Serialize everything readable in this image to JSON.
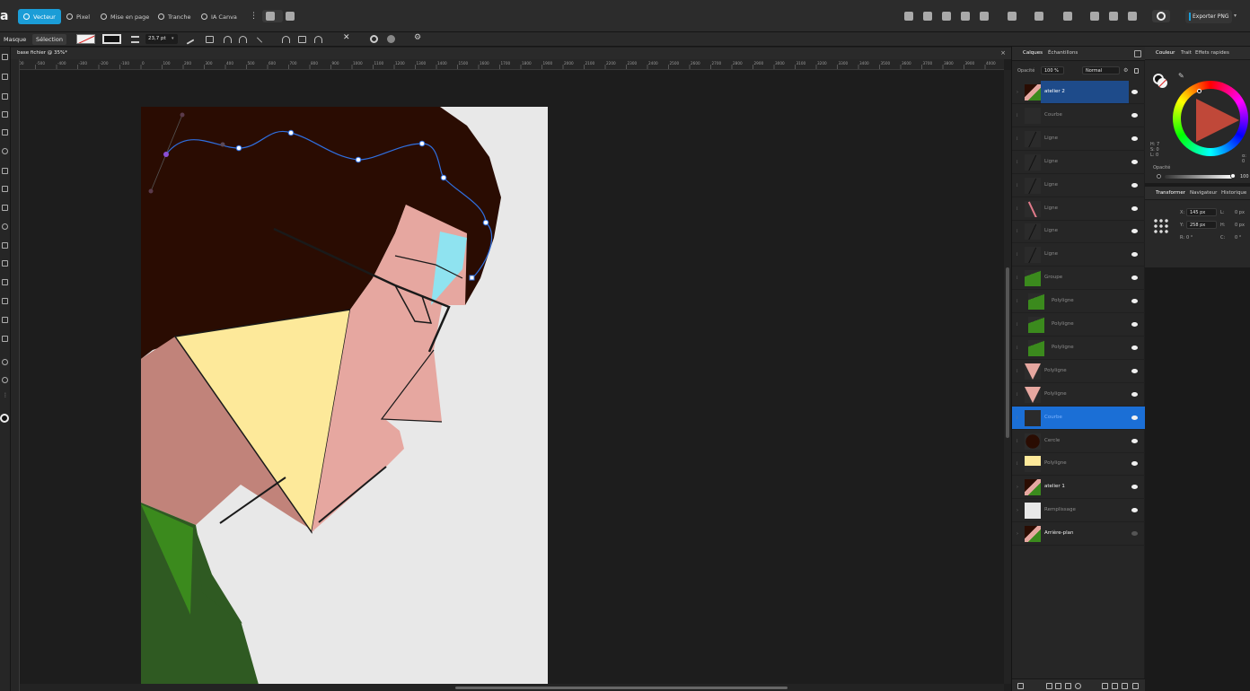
{
  "topbar": {
    "personas": [
      {
        "label": "Vecteur",
        "active": true
      },
      {
        "label": "Pixel",
        "active": false
      },
      {
        "label": "Mise en page",
        "active": false
      },
      {
        "label": "Tranche",
        "active": false
      },
      {
        "label": "IA Canva",
        "active": false
      }
    ],
    "export_label": "Exporter PNG"
  },
  "context": {
    "mask_label": "Masque",
    "selection_label": "Sélection",
    "stroke_width": "23,7 pt"
  },
  "document": {
    "tab_title": "base fichier @ 35%*",
    "close_glyph": "×"
  },
  "ruler": {
    "ticks": [
      "-600",
      "-500",
      "-400",
      "-300",
      "-200",
      "-100",
      "0",
      "100",
      "200",
      "300",
      "400",
      "500",
      "600",
      "700",
      "800",
      "900",
      "1000",
      "1100",
      "1200",
      "1300",
      "1400",
      "1500",
      "1600",
      "1700",
      "1800",
      "1900",
      "2000",
      "2100",
      "2200",
      "2300",
      "2400",
      "2500",
      "2600",
      "2700",
      "2800",
      "2900",
      "3000",
      "3100",
      "3200",
      "3300",
      "3400",
      "3500",
      "3600",
      "3700",
      "3800",
      "3900",
      "4000",
      "4100",
      "4200",
      "4300",
      "4400",
      "4500",
      "4600",
      "4700",
      "4800"
    ]
  },
  "layers_panel": {
    "tabs": [
      "Calques",
      "Échantillons"
    ],
    "opacity_label": "Opacité",
    "opacity_value": "100 %",
    "blend_mode": "Normal",
    "layers": [
      {
        "name": "atelier 2",
        "main": true,
        "selected": "name",
        "thumb": "figure",
        "indent": 0
      },
      {
        "name": "Courbe",
        "main": false,
        "thumb": "dark",
        "indent": 1
      },
      {
        "name": "Ligne",
        "main": false,
        "thumb": "line",
        "indent": 1
      },
      {
        "name": "Ligne",
        "main": false,
        "thumb": "line",
        "indent": 1
      },
      {
        "name": "Ligne",
        "main": false,
        "thumb": "line",
        "indent": 1
      },
      {
        "name": "Ligne",
        "main": false,
        "thumb": "pinkline",
        "indent": 1
      },
      {
        "name": "Ligne",
        "main": false,
        "thumb": "line",
        "indent": 1
      },
      {
        "name": "Ligne",
        "main": false,
        "thumb": "line",
        "indent": 1
      },
      {
        "name": "Groupe",
        "main": false,
        "thumb": "green",
        "indent": 1
      },
      {
        "name": "Polyligne",
        "main": false,
        "thumb": "green",
        "indent": 2
      },
      {
        "name": "Polyligne",
        "main": false,
        "thumb": "green",
        "indent": 2
      },
      {
        "name": "Polyligne",
        "main": false,
        "thumb": "green",
        "indent": 2
      },
      {
        "name": "Polyligne",
        "main": false,
        "thumb": "pink",
        "indent": 1
      },
      {
        "name": "Polyligne",
        "main": false,
        "thumb": "pink",
        "indent": 1
      },
      {
        "name": "Courbe",
        "main": false,
        "selected": "full",
        "thumb": "dark",
        "indent": 1
      },
      {
        "name": "Cercle",
        "main": false,
        "thumb": "brown",
        "indent": 1
      },
      {
        "name": "Polyligne",
        "main": false,
        "thumb": "yellow",
        "indent": 1
      },
      {
        "name": "atelier 1",
        "main": true,
        "thumb": "figure",
        "indent": 0
      },
      {
        "name": "Remplissage",
        "main": false,
        "thumb": "white",
        "indent": 0
      },
      {
        "name": "Arrière-plan",
        "main": true,
        "thumb": "figure",
        "indent": 0,
        "eye_off": true
      }
    ]
  },
  "color_panel": {
    "tabs": [
      "Couleur",
      "Trait",
      "Effets rapides"
    ],
    "opacity_label": "Opacité",
    "opacity_value": "100",
    "hsl_readout": [
      "H: 7",
      "S: 0",
      "L: 0"
    ],
    "alpha_label": "α: 0"
  },
  "transform_panel": {
    "tabs": [
      "Transformer",
      "Navigateur",
      "Historique"
    ],
    "x_label": "X:",
    "x_value": "145 px",
    "y_label": "Y:",
    "y_value": "258 px",
    "w_label": "L:",
    "w_value": "0 px",
    "h_label": "H:",
    "h_value": "0 px",
    "r_label": "R:",
    "r_value": "0 °",
    "s_label": "C:",
    "s_value": "0 °"
  },
  "colors": {
    "accent": "#1b9dd7",
    "selection": "#1b6fd6",
    "hair": "#2a0c02",
    "skin": "#e6a7a0",
    "skin_shadow": "#c1837a",
    "yellow": "#fde99a",
    "green_dark": "#2f5a22",
    "green_light": "#3b8a1d",
    "paper": "#e8e8e8",
    "glass": "#8fe3f0"
  }
}
